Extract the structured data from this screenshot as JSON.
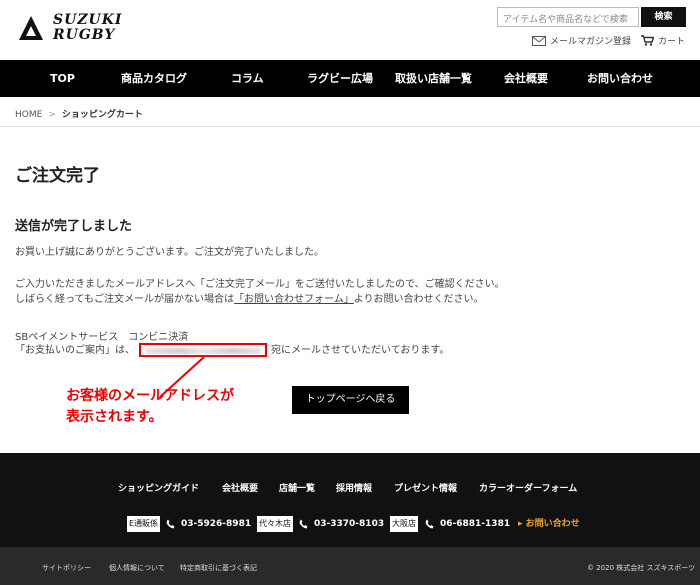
{
  "brand": {
    "line1": "SUZUKI",
    "line2": "RUGBY"
  },
  "search": {
    "placeholder": "アイテム名や商品名などで検索",
    "button": "検索"
  },
  "header_links": {
    "mail": "メールマガジン登録",
    "cart": "カート"
  },
  "nav": [
    "TOP",
    "商品カタログ",
    "コラム",
    "ラグビー広場",
    "取扱い店舗一覧",
    "会社概要",
    "お問い合わせ"
  ],
  "breadcrumb": {
    "home": "HOME",
    "sep": ">",
    "current": "ショッピングカート"
  },
  "main": {
    "title": "ご注文完了",
    "subtitle": "送信が完了しました",
    "thanks": "お買い上げ誠にありがとうございます。ご注文が完了いたしました。",
    "confirm_line1": "ご入力いただきましたメールアドレスへ「ご注文完了メール」をご送付いたしましたので、ご確認ください。",
    "confirm_line2_pre": "しばらく経ってもご注文メールが届かない場合は",
    "confirm_line2_link": "「お問い合わせフォーム」",
    "confirm_line2_post": "よりお問い合わせください。",
    "payment_line1": "SBペイメントサービス　コンビニ決済",
    "payment_line2_pre": "「お支払いのご案内」は、",
    "payment_line2_post": "宛にメールさせていただいております。",
    "back_button": "トップページへ戻る"
  },
  "annotation": {
    "line1": "お客様のメールアドレスが",
    "line2": "表示されます。",
    "color": "#e00000"
  },
  "footer": {
    "links": [
      "ショッピングガイド",
      "会社概要",
      "店舗一覧",
      "採用情報",
      "プレゼント情報",
      "カラーオーダーフォーム"
    ],
    "contacts": [
      {
        "label": "E通販係",
        "phone": "03-5926-8981"
      },
      {
        "label": "代々木店",
        "phone": "03-3370-8103"
      },
      {
        "label": "大阪店",
        "phone": "06-6881-1381"
      }
    ],
    "contact_link": "▸ お問い合わせ",
    "bottom_links": [
      "サイトポリシー",
      "個人情報について",
      "特定商取引に基づく表記"
    ],
    "copyright": "© 2020 株式会社 スズキスポーツ"
  }
}
